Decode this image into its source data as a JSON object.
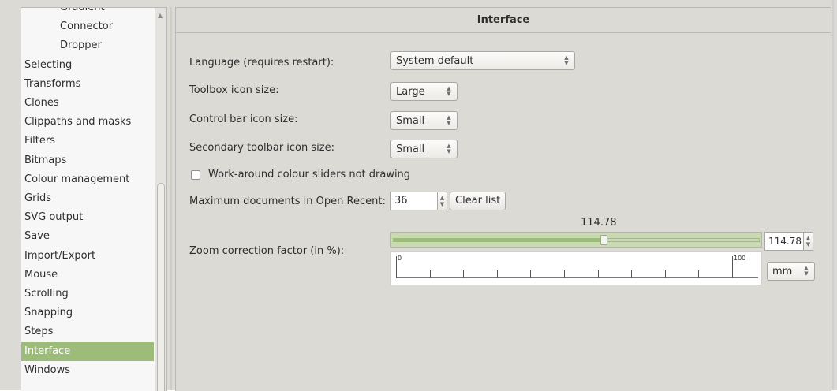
{
  "sidebar": {
    "items": [
      {
        "label": "Gradient",
        "level": "sub",
        "selected": false
      },
      {
        "label": "Connector",
        "level": "sub",
        "selected": false
      },
      {
        "label": "Dropper",
        "level": "sub",
        "selected": false
      },
      {
        "label": "Selecting",
        "level": "top",
        "selected": false
      },
      {
        "label": "Transforms",
        "level": "top",
        "selected": false
      },
      {
        "label": "Clones",
        "level": "top",
        "selected": false
      },
      {
        "label": "Clippaths and masks",
        "level": "top",
        "selected": false
      },
      {
        "label": "Filters",
        "level": "top",
        "selected": false
      },
      {
        "label": "Bitmaps",
        "level": "top",
        "selected": false
      },
      {
        "label": "Colour management",
        "level": "top",
        "selected": false
      },
      {
        "label": "Grids",
        "level": "top",
        "selected": false
      },
      {
        "label": "SVG output",
        "level": "top",
        "selected": false
      },
      {
        "label": "Save",
        "level": "top",
        "selected": false
      },
      {
        "label": "Import/Export",
        "level": "top",
        "selected": false
      },
      {
        "label": "Mouse",
        "level": "top",
        "selected": false
      },
      {
        "label": "Scrolling",
        "level": "top",
        "selected": false
      },
      {
        "label": "Snapping",
        "level": "top",
        "selected": false
      },
      {
        "label": "Steps",
        "level": "top",
        "selected": false
      },
      {
        "label": "Interface",
        "level": "top",
        "selected": true
      },
      {
        "label": "Windows",
        "level": "top",
        "selected": false
      }
    ],
    "scroll_up_icon": "up-triangle-icon"
  },
  "panel": {
    "title": "Interface",
    "language": {
      "label": "Language (requires restart):",
      "value": "System default"
    },
    "toolbox_icon_size": {
      "label": "Toolbox icon size:",
      "value": "Large"
    },
    "control_bar_icon_size": {
      "label": "Control bar icon size:",
      "value": "Small"
    },
    "secondary_toolbar_icon_size": {
      "label": "Secondary toolbar icon size:",
      "value": "Small"
    },
    "colour_sliders_workaround": {
      "label": "Work-around colour sliders not drawing",
      "checked": false
    },
    "max_recent": {
      "label": "Maximum documents in Open Recent:",
      "value": "36",
      "clear_label": "Clear list"
    },
    "zoom": {
      "label": "Zoom correction factor (in %):",
      "value_display": "114.78",
      "entry_value": "114.78",
      "slider_fraction": 0.5739,
      "unit": "mm",
      "ruler_start": "0",
      "ruler_end": "100",
      "ruler_ticks": 11
    }
  },
  "colors": {
    "accent": "#9dbc79",
    "slider_bg": "#c9d9b4",
    "background": "#dcdad5"
  }
}
